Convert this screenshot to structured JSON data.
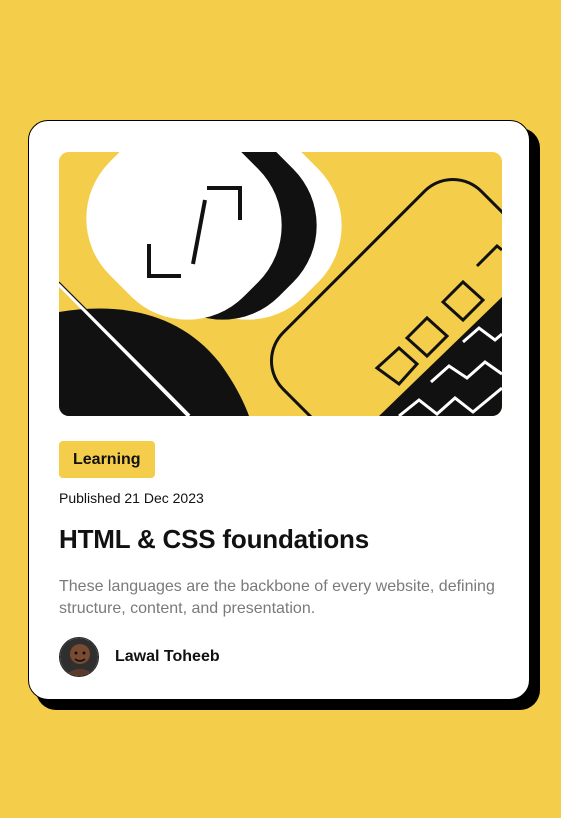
{
  "card": {
    "tag": "Learning",
    "published": "Published 21 Dec 2023",
    "title": "HTML & CSS foundations",
    "description": "These languages are the backbone of every website, defining structure, content, and presentation.",
    "author": {
      "name": "Lawal Toheeb"
    }
  },
  "colors": {
    "background": "#F4CE4B",
    "card": "#FFFFFF",
    "text": "#111111",
    "muted": "#7A7A7A"
  },
  "icons": {
    "hero": "abstract-illustration",
    "avatar": "person-photo"
  }
}
